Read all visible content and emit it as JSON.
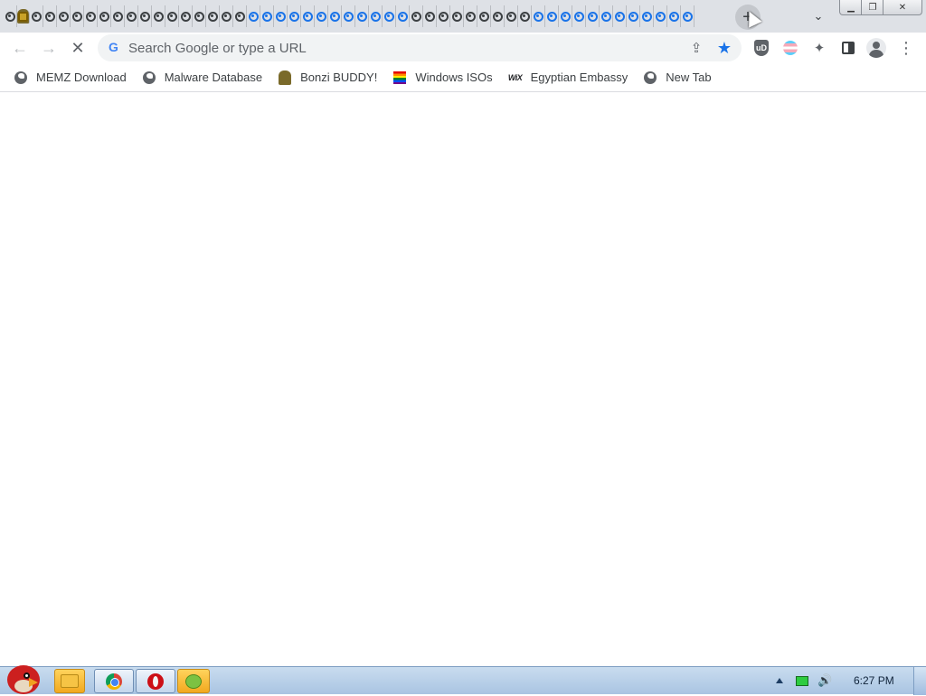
{
  "tabs": {
    "items": [
      {
        "icon": "site-icon",
        "style": "dark"
      },
      {
        "icon": "bonzi-icon",
        "style": "bonzi"
      },
      {
        "icon": "site-icon",
        "style": "dark"
      },
      {
        "icon": "site-icon",
        "style": "dark"
      },
      {
        "icon": "site-icon",
        "style": "dark"
      },
      {
        "icon": "site-icon",
        "style": "dark"
      },
      {
        "icon": "site-icon",
        "style": "dark"
      },
      {
        "icon": "site-icon",
        "style": "dark"
      },
      {
        "icon": "site-icon",
        "style": "dark"
      },
      {
        "icon": "site-icon",
        "style": "dark"
      },
      {
        "icon": "site-icon",
        "style": "dark"
      },
      {
        "icon": "site-icon",
        "style": "dark"
      },
      {
        "icon": "site-icon",
        "style": "dark"
      },
      {
        "icon": "site-icon",
        "style": "dark"
      },
      {
        "icon": "site-icon",
        "style": "dark"
      },
      {
        "icon": "site-icon",
        "style": "dark"
      },
      {
        "icon": "site-icon",
        "style": "dark"
      },
      {
        "icon": "site-icon",
        "style": "dark"
      },
      {
        "icon": "loading-icon",
        "style": "blue"
      },
      {
        "icon": "loading-icon",
        "style": "blue"
      },
      {
        "icon": "loading-icon",
        "style": "blue"
      },
      {
        "icon": "loading-icon",
        "style": "blue"
      },
      {
        "icon": "loading-icon",
        "style": "blue"
      },
      {
        "icon": "loading-icon",
        "style": "blue"
      },
      {
        "icon": "loading-icon",
        "style": "blue"
      },
      {
        "icon": "loading-icon",
        "style": "blue"
      },
      {
        "icon": "loading-icon",
        "style": "blue"
      },
      {
        "icon": "loading-icon",
        "style": "blue"
      },
      {
        "icon": "loading-icon",
        "style": "blue"
      },
      {
        "icon": "loading-icon",
        "style": "blue"
      },
      {
        "icon": "site-icon",
        "style": "dark"
      },
      {
        "icon": "site-icon",
        "style": "dark"
      },
      {
        "icon": "site-icon",
        "style": "dark"
      },
      {
        "icon": "site-icon",
        "style": "dark"
      },
      {
        "icon": "site-icon",
        "style": "dark"
      },
      {
        "icon": "site-icon",
        "style": "dark"
      },
      {
        "icon": "site-icon",
        "style": "dark"
      },
      {
        "icon": "site-icon",
        "style": "dark"
      },
      {
        "icon": "site-icon",
        "style": "dark"
      },
      {
        "icon": "loading-icon",
        "style": "blue"
      },
      {
        "icon": "loading-icon",
        "style": "blue"
      },
      {
        "icon": "loading-icon",
        "style": "blue"
      },
      {
        "icon": "loading-icon",
        "style": "blue"
      },
      {
        "icon": "loading-icon",
        "style": "blue"
      },
      {
        "icon": "loading-icon",
        "style": "blue"
      },
      {
        "icon": "loading-icon",
        "style": "blue"
      },
      {
        "icon": "loading-icon",
        "style": "blue"
      },
      {
        "icon": "loading-icon",
        "style": "blue"
      },
      {
        "icon": "loading-icon",
        "style": "blue"
      },
      {
        "icon": "loading-icon",
        "style": "blue"
      },
      {
        "icon": "loading-icon",
        "style": "blue"
      }
    ],
    "new_tab_label": "+",
    "tab_search_label": "⌄"
  },
  "window_controls": {
    "minimize": "▁",
    "maximize": "❐",
    "close": "✕"
  },
  "toolbar": {
    "back": "←",
    "forward": "→",
    "reload": "✕",
    "omnibox_placeholder": "Search Google or type a URL",
    "omnibox_value": "",
    "google_logo": "G",
    "share": "⇪",
    "bookmark_star": "★",
    "extensions": "✦",
    "ublock_text": "uD",
    "menu": "⋮"
  },
  "bookmarks": [
    {
      "label": "MEMZ Download",
      "icon": "globe-icon"
    },
    {
      "label": "Malware Database",
      "icon": "globe-icon"
    },
    {
      "label": "Bonzi BUDDY!",
      "icon": "bonzi-icon"
    },
    {
      "label": "Windows ISOs",
      "icon": "rainbow-flag-icon"
    },
    {
      "label": "Egyptian Embassy",
      "icon": "wix-icon",
      "icon_text": "WiX"
    },
    {
      "label": "New Tab",
      "icon": "globe-icon"
    }
  ],
  "taskbar": {
    "clock": "6:27 PM",
    "apps": [
      {
        "name": "explorer",
        "icon": "folder-icon"
      },
      {
        "name": "chrome",
        "icon": "chrome-icon"
      },
      {
        "name": "opera",
        "icon": "opera-icon"
      },
      {
        "name": "game",
        "icon": "green-pig-icon"
      }
    ],
    "volume": "🔊"
  },
  "colors": {
    "tabstrip_bg": "#dee1e6",
    "accent_blue": "#1a73e8",
    "taskbar_bg": "#b9d0ea"
  }
}
